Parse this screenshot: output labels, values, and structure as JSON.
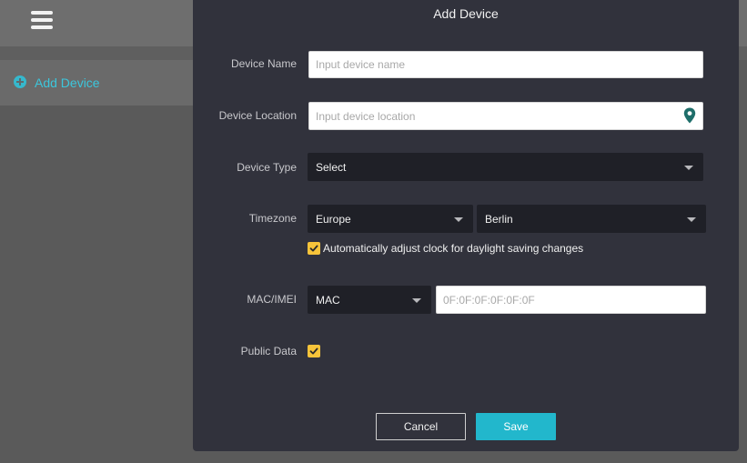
{
  "sidebar": {
    "items": [
      {
        "label": "Add Device",
        "icon": "plus-circle-icon"
      }
    ]
  },
  "modal": {
    "title": "Add Device",
    "device_name": {
      "label": "Device Name",
      "placeholder": "Input device name",
      "value": ""
    },
    "device_location": {
      "label": "Device Location",
      "placeholder": "Input device location",
      "value": "",
      "icon": "map-pin-icon"
    },
    "device_type": {
      "label": "Device Type",
      "selected": "Select"
    },
    "timezone": {
      "label": "Timezone",
      "region": "Europe",
      "city": "Berlin",
      "dst_label": "Automatically adjust clock for daylight saving changes",
      "dst_checked": true
    },
    "mac_imei": {
      "label": "MAC/IMEI",
      "type_selected": "MAC",
      "placeholder": "0F:0F:0F:0F:0F:0F",
      "value": ""
    },
    "public_data": {
      "label": "Public Data",
      "checked": true
    },
    "buttons": {
      "cancel": "Cancel",
      "save": "Save"
    }
  },
  "colors": {
    "accent": "#22b7cc",
    "checkbox": "#f7c43a",
    "modal_bg": "#31323c",
    "select_bg": "#1f2027"
  }
}
